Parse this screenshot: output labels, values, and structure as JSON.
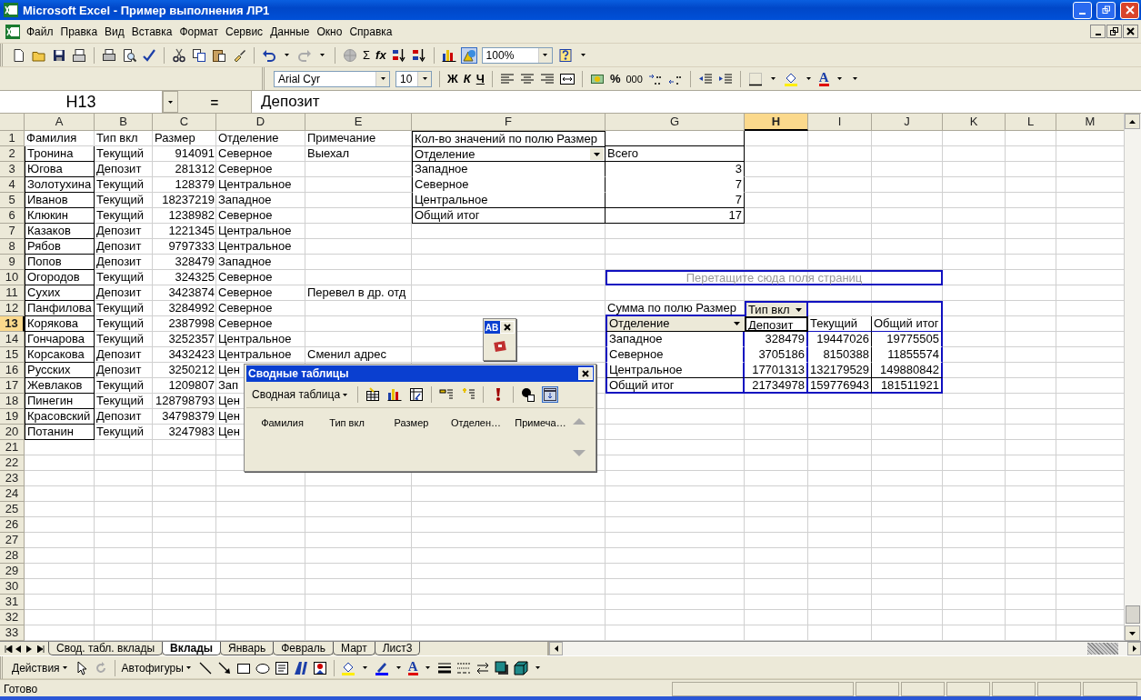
{
  "window": {
    "title": "Microsoft Excel - Пример выполнения ЛР1"
  },
  "menu": [
    "Файл",
    "Правка",
    "Вид",
    "Вставка",
    "Формат",
    "Сервис",
    "Данные",
    "Окно",
    "Справка"
  ],
  "standard_toolbar": {
    "sum": "Σ",
    "function": "fx",
    "zoom": "100%",
    "drawing_on": true
  },
  "format_toolbar": {
    "font": "Arial Cyr",
    "size": "10",
    "bold": "Ж",
    "italic": "К",
    "underline": "Ч",
    "percent": "%",
    "thousands": "000",
    "font_color": "A"
  },
  "formula_bar": {
    "name_box": "H13",
    "equals": "=",
    "value": "Депозит"
  },
  "sheet": {
    "columns": [
      {
        "label": "A",
        "selected": false
      },
      {
        "label": "B",
        "selected": false
      },
      {
        "label": "C",
        "selected": false
      },
      {
        "label": "D",
        "selected": false
      },
      {
        "label": "E",
        "selected": false
      },
      {
        "label": "F",
        "selected": false
      },
      {
        "label": "G",
        "selected": false
      },
      {
        "label": "H",
        "selected": true
      },
      {
        "label": "I",
        "selected": false
      },
      {
        "label": "J",
        "selected": false
      },
      {
        "label": "K",
        "selected": false
      },
      {
        "label": "L",
        "selected": false
      },
      {
        "label": "M",
        "selected": false
      }
    ],
    "rows": [
      {
        "label": "1",
        "selected": false,
        "cells": [
          "Фамилия",
          "Тип вкл",
          "Размер",
          "Отделение",
          "Примечание"
        ]
      },
      {
        "label": "2",
        "selected": false,
        "cells": [
          "Тронина",
          "Текущий",
          "914091",
          "Северное",
          "Выехал"
        ]
      },
      {
        "label": "3",
        "selected": false,
        "cells": [
          "Югова",
          "Депозит",
          "281312",
          "Северное"
        ]
      },
      {
        "label": "4",
        "selected": false,
        "cells": [
          "Золотухина",
          "Текущий",
          "128379",
          "Центральное"
        ]
      },
      {
        "label": "5",
        "selected": false,
        "cells": [
          "Иванов",
          "Текущий",
          "18237219",
          "Западное"
        ]
      },
      {
        "label": "6",
        "selected": false,
        "cells": [
          "Клюкин",
          "Текущий",
          "1238982",
          "Северное"
        ]
      },
      {
        "label": "7",
        "selected": false,
        "cells": [
          "Казаков",
          "Депозит",
          "1221345",
          "Центральное"
        ]
      },
      {
        "label": "8",
        "selected": false,
        "cells": [
          "Рябов",
          "Депозит",
          "9797333",
          "Центральное"
        ]
      },
      {
        "label": "9",
        "selected": false,
        "cells": [
          "Попов",
          "Депозит",
          "328479",
          "Западное"
        ]
      },
      {
        "label": "10",
        "selected": false,
        "cells": [
          "Огородов",
          "Текущий",
          "324325",
          "Северное"
        ]
      },
      {
        "label": "11",
        "selected": false,
        "cells": [
          "Сухих",
          "Депозит",
          "3423874",
          "Северное",
          "Перевел в др. отд"
        ]
      },
      {
        "label": "12",
        "selected": false,
        "cells": [
          "Панфилова",
          "Текущий",
          "3284992",
          "Северное"
        ]
      },
      {
        "label": "13",
        "selected": true,
        "cells": [
          "Корякова",
          "Текущий",
          "2387998",
          "Северное"
        ]
      },
      {
        "label": "14",
        "selected": false,
        "cells": [
          "Гончарова",
          "Текущий",
          "3252357",
          "Центральное"
        ]
      },
      {
        "label": "15",
        "selected": false,
        "cells": [
          "Корсакова",
          "Депозит",
          "3432423",
          "Центральное",
          "Сменил адрес"
        ]
      },
      {
        "label": "16",
        "selected": false,
        "cells": [
          "Русских",
          "Депозит",
          "3250212",
          "Цен"
        ]
      },
      {
        "label": "17",
        "selected": false,
        "cells": [
          "Жевлаков",
          "Текущий",
          "1209807",
          "Зап"
        ]
      },
      {
        "label": "18",
        "selected": false,
        "cells": [
          "Пинегин",
          "Текущий",
          "128798793",
          "Цен"
        ]
      },
      {
        "label": "19",
        "selected": false,
        "cells": [
          "Красовский",
          "Депозит",
          "34798379",
          "Цен"
        ]
      },
      {
        "label": "20",
        "selected": false,
        "cells": [
          "Потанин",
          "Текущий",
          "3247983",
          "Цен"
        ]
      },
      {
        "label": "21",
        "selected": false
      },
      {
        "label": "22",
        "selected": false
      },
      {
        "label": "23",
        "selected": false
      },
      {
        "label": "24",
        "selected": false
      },
      {
        "label": "25",
        "selected": false
      },
      {
        "label": "26",
        "selected": false
      },
      {
        "label": "27",
        "selected": false
      },
      {
        "label": "28",
        "selected": false
      },
      {
        "label": "29",
        "selected": false
      },
      {
        "label": "30",
        "selected": false
      },
      {
        "label": "31",
        "selected": false
      },
      {
        "label": "32",
        "selected": false
      },
      {
        "label": "33",
        "selected": false
      }
    ]
  },
  "count_pivot": {
    "title": "Кол-во значений по полю Размер",
    "row_field": "Отделение",
    "total_header": "Всего",
    "rows": [
      {
        "label": "Западное",
        "value": "3"
      },
      {
        "label": "Северное",
        "value": "7"
      },
      {
        "label": "Центральное",
        "value": "7"
      },
      {
        "label": "Общий итог",
        "value": "17"
      }
    ]
  },
  "sum_pivot": {
    "drop_zone": "Перетащите сюда поля страниц",
    "data_field": "Сумма по полю Размер",
    "column_field": "Тип вкл",
    "row_field": "Отделение",
    "column_items": [
      "Депозит",
      "Текущий",
      "Общий итог"
    ],
    "rows": [
      {
        "label": "Западное",
        "values": [
          "328479",
          "19447026",
          "19775505"
        ]
      },
      {
        "label": "Северное",
        "values": [
          "3705186",
          "8150388",
          "11855574"
        ]
      },
      {
        "label": "Центральное",
        "values": [
          "17701313",
          "132179529",
          "149880842"
        ]
      },
      {
        "label": "Общий итог",
        "values": [
          "21734978",
          "159776943",
          "181511921"
        ]
      }
    ]
  },
  "spell_float": {
    "label": "AB"
  },
  "pivot_window": {
    "title": "Сводные таблицы",
    "menu": "Сводная таблица",
    "field_list_on": true,
    "fields": [
      "Фамилия",
      "Тип вкл",
      "Размер",
      "Отделен…",
      "Примеча…"
    ]
  },
  "sheet_tabs": [
    {
      "label": "Свод. табл. вклады",
      "selected": false
    },
    {
      "label": "Вклады",
      "selected": true
    },
    {
      "label": "Январь",
      "selected": false
    },
    {
      "label": "Февраль",
      "selected": false
    },
    {
      "label": "Март",
      "selected": false
    },
    {
      "label": "Лист3",
      "selected": false
    }
  ],
  "drawing_toolbar": {
    "actions": "Действия",
    "autoshapes": "Автофигуры",
    "font_color": "A"
  },
  "status_bar": {
    "text": "Готово"
  }
}
